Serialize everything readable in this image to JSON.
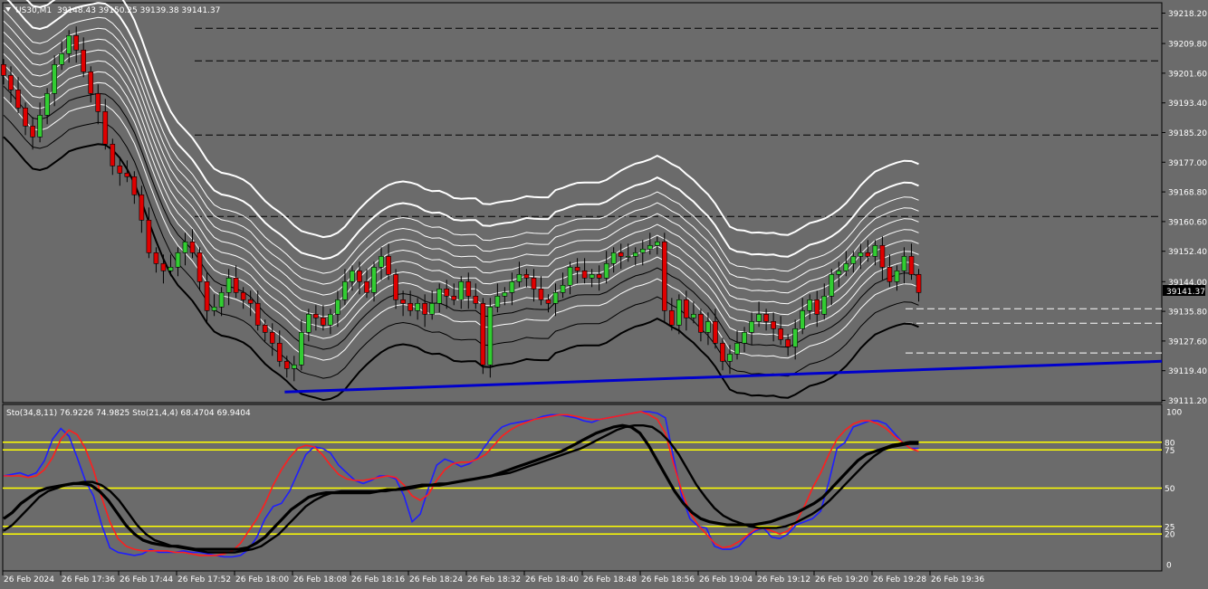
{
  "colors": {
    "background": "#6b6b6b",
    "axis_text": "#ffffff",
    "grid_line": "#000000",
    "bull_candle": "#32cd32",
    "bear_candle": "#e00000",
    "envelope_outer": "#ffffff",
    "envelope_lower": "#000000",
    "trendline": "#0000cc",
    "stoch_fast_main": "#1e1eff",
    "stoch_fast_signal": "#ff1e1e",
    "stoch_slow_main": "#000000",
    "stoch_level": "#ffff00",
    "price_marker": "#000000"
  },
  "header": {
    "menu_icon": "triangle-down-icon",
    "symbol": "US30,M1",
    "ohlc": "39148.43 39150.25 39139.38 39141.37"
  },
  "chart_data": [
    {
      "type": "candlestick",
      "symbol": "US30",
      "timeframe": "M1",
      "x_tick_labels": [
        "26 Feb 2024",
        "26 Feb 17:36",
        "26 Feb 17:44",
        "26 Feb 17:52",
        "26 Feb 18:00",
        "26 Feb 18:08",
        "26 Feb 18:16",
        "26 Feb 18:24",
        "26 Feb 18:32",
        "26 Feb 18:40",
        "26 Feb 18:48",
        "26 Feb 18:56",
        "26 Feb 19:04",
        "26 Feb 19:12",
        "26 Feb 19:20",
        "26 Feb 19:28",
        "26 Feb 19:36"
      ],
      "y_tick_labels": [
        "39218.20",
        "39209.80",
        "39201.60",
        "39193.40",
        "39185.20",
        "39177.00",
        "39168.80",
        "39160.60",
        "39152.40",
        "39144.00",
        "39135.80",
        "39127.60",
        "39119.40",
        "39111.20"
      ],
      "ylim": [
        39111.2,
        39218.2
      ],
      "current_price": "39141.37",
      "grid": false,
      "dashed_levels": [
        39214.0,
        39205.0,
        39184.5,
        39162.0,
        39136.5,
        39132.5,
        39124.3
      ],
      "trendline": {
        "from": [
          18.0,
          39113.5
        ],
        "to": [
          127.5,
          39122.0
        ]
      },
      "closes": [
        39201,
        39197,
        39192,
        39187,
        39184,
        39190,
        39196,
        39204,
        39207,
        39212,
        39208,
        39202,
        39196,
        39191,
        39182,
        39176,
        39174,
        39173,
        39168,
        39161,
        39152,
        39149,
        39147,
        39148,
        39152,
        39155,
        39152,
        39144,
        39136,
        39137,
        39141,
        39145,
        39141,
        39139,
        39138,
        39132,
        39130,
        39127,
        39122,
        39120,
        39121,
        39130,
        39135,
        39134,
        39132,
        39135,
        39139,
        39144,
        39147,
        39144,
        39141,
        39148,
        39151,
        39146,
        39139,
        39138,
        39136,
        39138,
        39135,
        39138,
        39142,
        39140,
        39139,
        39144,
        39140,
        39138,
        39121,
        39137,
        39140,
        39141,
        39144,
        39146,
        39145,
        39142,
        39139,
        39138,
        39141,
        39143,
        39148,
        39147,
        39145,
        39146,
        39145,
        39149,
        39152,
        39151,
        39151,
        39152,
        39153,
        39154,
        39155,
        39136,
        39132,
        39139,
        39134,
        39135,
        39130,
        39133,
        39127,
        39122,
        39124,
        39127,
        39130,
        39133,
        39135,
        39133,
        39131,
        39128,
        39126,
        39131,
        39136,
        39139,
        39135,
        39140,
        39146,
        39147,
        39149,
        39151,
        39152,
        39151,
        39154,
        39148,
        39144,
        39147,
        39151,
        39146,
        39141
      ],
      "series": [
        {
          "kind": "price",
          "values": [
            39201,
            39197,
            39192,
            39187,
            39184,
            39190,
            39196,
            39204,
            39207,
            39212,
            39208,
            39202,
            39196,
            39191,
            39182,
            39176,
            39174,
            39173,
            39168,
            39161,
            39152,
            39149,
            39147,
            39148,
            39152,
            39155,
            39152,
            39144,
            39136,
            39137,
            39141,
            39145,
            39141,
            39139,
            39138,
            39132,
            39130,
            39127,
            39122,
            39120,
            39121,
            39130,
            39135,
            39134,
            39132,
            39135,
            39139,
            39144,
            39147,
            39144,
            39141,
            39148,
            39151,
            39146,
            39139,
            39138,
            39136,
            39138,
            39135,
            39138,
            39142,
            39140,
            39139,
            39144,
            39140,
            39138,
            39121,
            39137,
            39140,
            39141,
            39144,
            39146,
            39145,
            39142,
            39139,
            39138,
            39141,
            39143,
            39148,
            39147,
            39145,
            39146,
            39145,
            39149,
            39152,
            39151,
            39151,
            39152,
            39153,
            39154,
            39155,
            39136,
            39132,
            39139,
            39134,
            39135,
            39130,
            39133,
            39127,
            39122,
            39124,
            39127,
            39130,
            39133,
            39135,
            39133,
            39131,
            39128,
            39126,
            39131,
            39136,
            39139,
            39135,
            39140,
            39146,
            39147,
            39149,
            39151,
            39152,
            39151,
            39154,
            39148,
            39144,
            39147,
            39151,
            39146,
            39141
          ]
        }
      ]
    },
    {
      "type": "line",
      "indicator_label": "Sto(34,8,11) 76.9226 74.9825  Sto(21,4,4) 68.4704 69.9404",
      "ylim": [
        0,
        100
      ],
      "y_tick_labels": [
        "100",
        "0"
      ],
      "levels": [
        80,
        75,
        50,
        25,
        20
      ],
      "level_labels": [
        "80",
        "75",
        "50",
        "25",
        "20"
      ],
      "series": [
        {
          "kind": "fast-main",
          "values": [
            58,
            59,
            60,
            58,
            60,
            68,
            82,
            89,
            84,
            70,
            55,
            45,
            26,
            11,
            8,
            7,
            6,
            7,
            10,
            8,
            8,
            8,
            9,
            8,
            8,
            7,
            6,
            5,
            5,
            6,
            10,
            18,
            30,
            38,
            40,
            48,
            60,
            72,
            77,
            76,
            73,
            65,
            60,
            55,
            53,
            55,
            58,
            58,
            56,
            45,
            28,
            33,
            50,
            65,
            69,
            67,
            64,
            66,
            70,
            78,
            85,
            90,
            92,
            93,
            94,
            95,
            97,
            98,
            98,
            97,
            96,
            94,
            93,
            95,
            96,
            97,
            98,
            99,
            100,
            100,
            99,
            96,
            70,
            45,
            30,
            25,
            24,
            12,
            10,
            10,
            12,
            18,
            22,
            24,
            18,
            17,
            20,
            26,
            28,
            30,
            35,
            54,
            76,
            80,
            90,
            92,
            94,
            94,
            92,
            86,
            80,
            76,
            76
          ]
        },
        {
          "kind": "fast-signal",
          "values": [
            58,
            58,
            58,
            57,
            58,
            62,
            70,
            82,
            88,
            85,
            76,
            62,
            44,
            28,
            17,
            12,
            10,
            9,
            9,
            9,
            9,
            8,
            8,
            7,
            6,
            6,
            6,
            7,
            9,
            14,
            22,
            30,
            40,
            52,
            62,
            70,
            76,
            78,
            77,
            72,
            65,
            59,
            56,
            55,
            55,
            56,
            57,
            58,
            57,
            52,
            45,
            42,
            46,
            55,
            62,
            66,
            67,
            67,
            69,
            72,
            78,
            84,
            88,
            91,
            93,
            95,
            96,
            97,
            98,
            98,
            97,
            96,
            95,
            95,
            96,
            97,
            98,
            99,
            100,
            98,
            95,
            86,
            66,
            48,
            34,
            26,
            20,
            14,
            11,
            12,
            15,
            19,
            23,
            24,
            22,
            20,
            22,
            28,
            38,
            50,
            60,
            72,
            82,
            88,
            92,
            94,
            94,
            92,
            89,
            84,
            80,
            76,
            74
          ]
        },
        {
          "kind": "slow-main",
          "values": [
            30,
            34,
            40,
            44,
            48,
            50,
            51,
            52,
            53,
            53,
            52,
            48,
            42,
            34,
            26,
            20,
            16,
            14,
            13,
            12,
            12,
            11,
            10,
            10,
            10,
            10,
            10,
            10,
            11,
            14,
            18,
            24,
            30,
            36,
            40,
            44,
            46,
            47,
            47,
            47,
            47,
            47,
            47,
            48,
            49,
            49,
            50,
            51,
            52,
            52,
            52,
            53,
            54,
            55,
            56,
            57,
            58,
            60,
            62,
            64,
            66,
            68,
            70,
            72,
            74,
            77,
            80,
            83,
            86,
            88,
            90,
            91,
            90,
            86,
            78,
            68,
            58,
            48,
            40,
            34,
            30,
            28,
            27,
            26,
            26,
            26,
            26,
            27,
            28,
            30,
            32,
            34,
            37,
            40,
            44,
            50,
            56,
            62,
            68,
            72,
            74,
            76,
            78,
            79,
            80,
            80
          ]
        },
        {
          "kind": "slow-signal",
          "values": [
            22,
            26,
            32,
            38,
            44,
            48,
            50,
            52,
            53,
            54,
            54,
            52,
            48,
            42,
            34,
            26,
            20,
            16,
            14,
            12,
            11,
            10,
            9,
            8,
            8,
            8,
            8,
            9,
            10,
            12,
            16,
            20,
            26,
            32,
            38,
            42,
            45,
            47,
            48,
            48,
            48,
            48,
            48,
            48,
            49,
            49,
            50,
            51,
            52,
            53,
            53,
            54,
            55,
            56,
            57,
            58,
            59,
            60,
            62,
            64,
            66,
            68,
            70,
            72,
            74,
            76,
            79,
            82,
            85,
            88,
            90,
            91,
            91,
            90,
            86,
            80,
            72,
            62,
            52,
            44,
            37,
            32,
            29,
            27,
            25,
            24,
            24,
            24,
            25,
            27,
            30,
            33,
            37,
            42,
            48,
            54,
            60,
            66,
            71,
            75,
            77,
            78,
            79,
            79
          ]
        }
      ]
    }
  ]
}
